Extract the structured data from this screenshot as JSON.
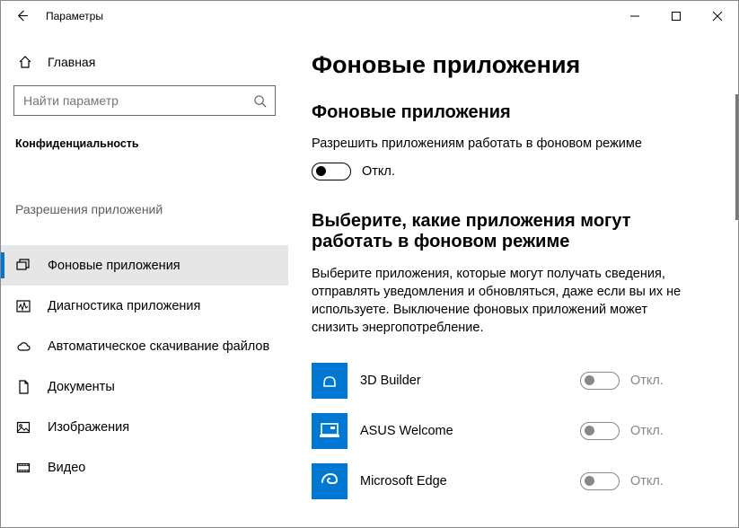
{
  "titlebar": {
    "title": "Параметры"
  },
  "sidebar": {
    "home": "Главная",
    "search_placeholder": "Найти параметр",
    "category": "Конфиденциальность",
    "section_label": "Разрешения приложений",
    "items": [
      {
        "label": "Фоновые приложения"
      },
      {
        "label": "Диагностика приложения"
      },
      {
        "label": "Автоматическое скачивание файлов"
      },
      {
        "label": "Документы"
      },
      {
        "label": "Изображения"
      },
      {
        "label": "Видео"
      }
    ]
  },
  "main": {
    "title": "Фоновые приложения",
    "sub1": "Фоновые приложения",
    "allow_label": "Разрешить приложениям работать в фоновом режиме",
    "master_state": "Откл.",
    "sub2": "Выберите, какие приложения могут работать в фоновом режиме",
    "desc": "Выберите приложения, которые могут получать сведения, отправлять уведомления и обновляться, даже если вы их не используете. Выключение фоновых приложений может снизить энергопотребление.",
    "apps": [
      {
        "name": "3D Builder",
        "state": "Откл."
      },
      {
        "name": "ASUS Welcome",
        "state": "Откл."
      },
      {
        "name": "Microsoft Edge",
        "state": "Откл."
      }
    ]
  }
}
